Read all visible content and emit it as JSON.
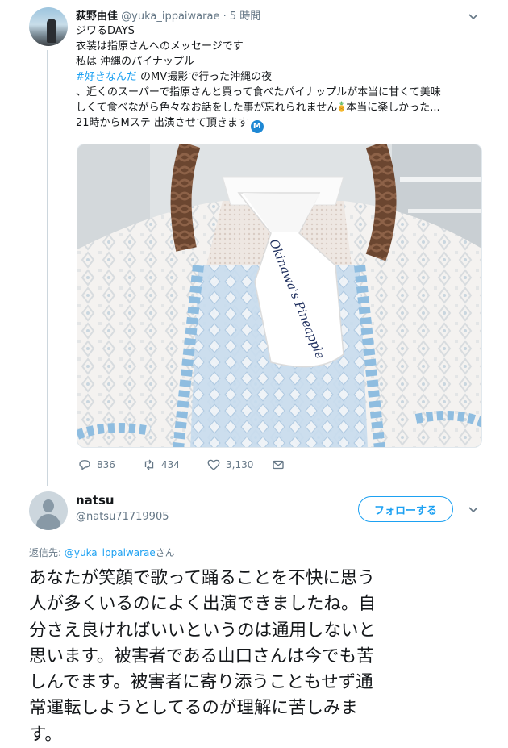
{
  "parent_tweet": {
    "display_name": "荻野由佳",
    "handle": "@yuka_ippaiwarae",
    "separator": "·",
    "time": "5 時間",
    "text_lines": [
      "ジワるDAYS",
      "衣装は指原さんへのメッセージです",
      "私は 沖縄のパイナップル"
    ],
    "hashtag": "#好きなんだ",
    "hashtag_line_rest": " のMV撮影で行った沖縄の夜",
    "body_line_1": "、近くのスーパーで指原さんと買って食べたパイナップルが本当に甘くて美味",
    "body_line_2_a": "しくて食べながら色々なお話をした事が忘れられません",
    "body_line_2_b": "本当に楽しかった...",
    "body_line_3": "21時からMステ 出演させて頂きます",
    "m_badge": "M",
    "photo_ribbon_text": "Okinawa's Pineapple",
    "stats": {
      "replies": "836",
      "retweets": "434",
      "likes": "3,130"
    },
    "icons": [
      "reply-icon",
      "retweet-icon",
      "like-icon",
      "direct-message-icon",
      "chevron-down-icon",
      "pineapple-icon"
    ]
  },
  "reply_tweet": {
    "display_name": "natsu",
    "handle": "@natsu71719905",
    "follow_label": "フォローする",
    "replying_prefix": "返信先: ",
    "replying_mention": "@yuka_ippaiwarae",
    "replying_suffix": "さん",
    "text_lines": [
      "あなたが笑顔で歌って踊ることを不快に思う",
      "人が多くいるのによく出演できましたね。自",
      "分さえ良ければいいというのは通用しないと",
      "思います。被害者である山口さんは今でも苦",
      "しんでます。被害者に寄り添うこともせず通",
      "常運転しようとしてるのが理解に苦しみま",
      "す。"
    ]
  },
  "colors": {
    "accent": "#1da1f2",
    "secondary_text": "#657786",
    "thread_line": "#ccd6dd"
  }
}
